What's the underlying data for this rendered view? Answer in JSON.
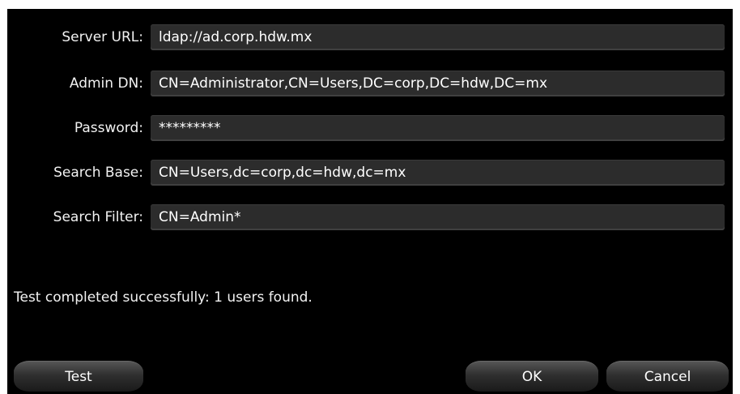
{
  "fields": [
    {
      "label": "Server URL:",
      "value": "ldap://ad.corp.hdw.mx"
    },
    {
      "label": "Admin DN:",
      "value": "CN=Administrator,CN=Users,DC=corp,DC=hdw,DC=mx"
    },
    {
      "label": "Password:",
      "value": "*********"
    },
    {
      "label": "Search Base:",
      "value": "CN=Users,dc=corp,dc=hdw,dc=mx"
    },
    {
      "label": "Search Filter:",
      "value": "CN=Admin*"
    }
  ],
  "status_text": "Test completed successfully: 1 users found.",
  "buttons": {
    "test": "Test",
    "ok": "OK",
    "cancel": "Cancel"
  }
}
